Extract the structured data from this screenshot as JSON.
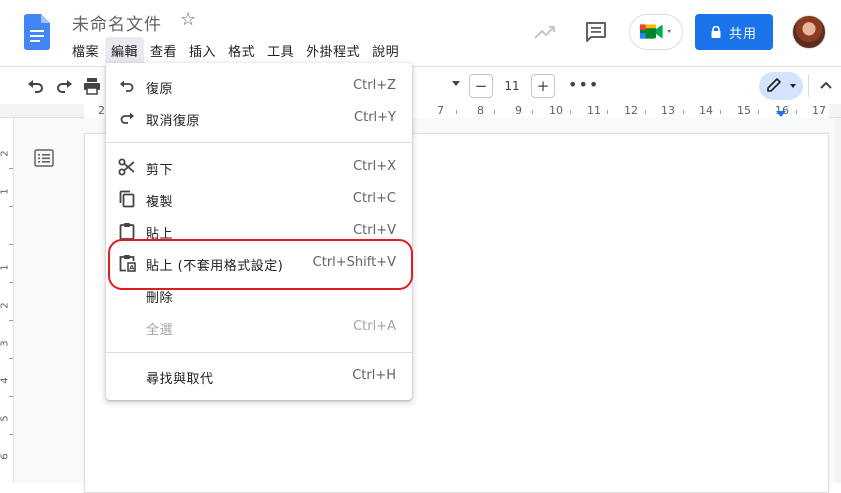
{
  "header": {
    "doc_title": "未命名文件",
    "menu": [
      "檔案",
      "編輯",
      "查看",
      "插入",
      "格式",
      "工具",
      "外掛程式",
      "說明"
    ],
    "active_menu_index": 1,
    "share_label": "共用"
  },
  "toolbar": {
    "font_size": "11",
    "minus": "−",
    "plus": "+",
    "more": "•••"
  },
  "ruler": {
    "labels": [
      "2",
      "7",
      "8",
      "9",
      "10",
      "11",
      "12",
      "13",
      "14",
      "15",
      "16",
      "17"
    ]
  },
  "vruler": {
    "labels": [
      "2",
      "1",
      "1",
      "2",
      "3",
      "4",
      "5",
      "6"
    ]
  },
  "edit_menu": {
    "items": [
      {
        "label": "復原",
        "shortcut": "Ctrl+Z",
        "icon": "undo-icon",
        "disabled": false
      },
      {
        "label": "取消復原",
        "shortcut": "Ctrl+Y",
        "icon": "redo-icon",
        "disabled": false
      },
      {
        "label": "剪下",
        "shortcut": "Ctrl+X",
        "icon": "scissors-icon",
        "disabled": false
      },
      {
        "label": "複製",
        "shortcut": "Ctrl+C",
        "icon": "copy-icon",
        "disabled": false
      },
      {
        "label": "貼上",
        "shortcut": "Ctrl+V",
        "icon": "clipboard-icon",
        "disabled": false
      },
      {
        "label": "貼上 (不套用格式設定)",
        "shortcut": "Ctrl+Shift+V",
        "icon": "paste-plain-icon",
        "disabled": false
      },
      {
        "label": "刪除",
        "shortcut": "",
        "icon": "",
        "disabled": false
      },
      {
        "label": "全選",
        "shortcut": "Ctrl+A",
        "icon": "",
        "disabled": true
      },
      {
        "label": "尋找與取代",
        "shortcut": "Ctrl+H",
        "icon": "",
        "disabled": false
      }
    ]
  },
  "colors": {
    "accent": "#1a73e8",
    "highlight_ring": "#e11b22",
    "docs_blue": "#4285f4"
  }
}
